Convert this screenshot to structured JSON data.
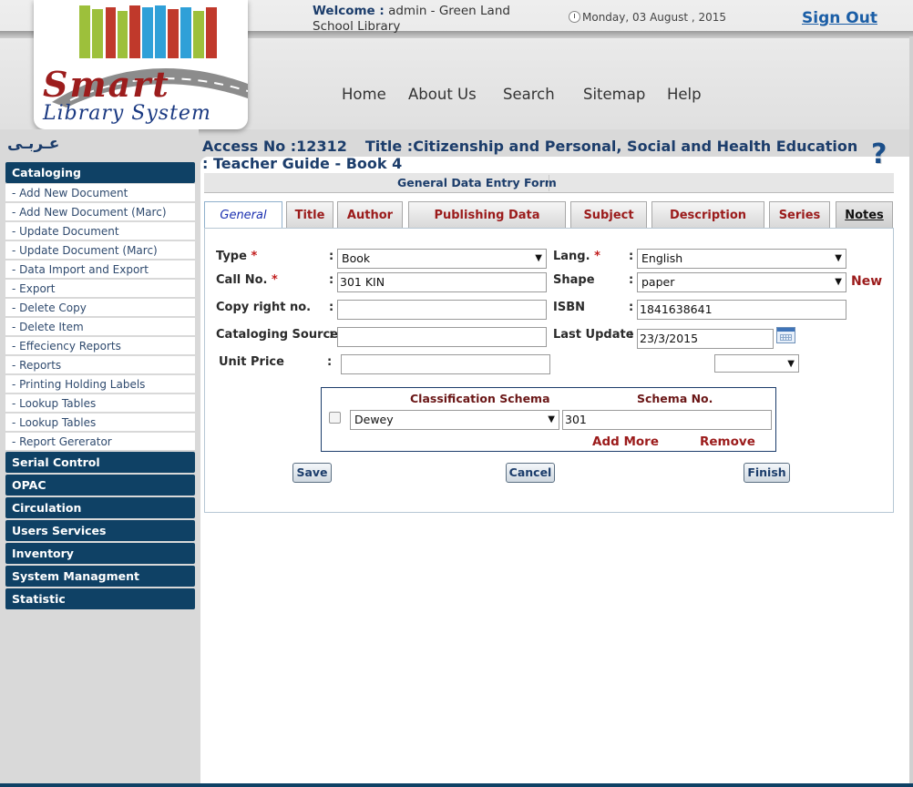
{
  "header": {
    "welcome_label": "Welcome :",
    "welcome_text": "admin - Green Land School Library",
    "date": "Monday, 03 August , 2015",
    "sign_out": "Sign Out",
    "logo_line1": "Smart",
    "logo_line2": "Library System",
    "nav": [
      "Home",
      "About Us",
      "Search",
      "Sitemap",
      "Help"
    ]
  },
  "sidebar": {
    "language_link": "عـربـى",
    "sections": [
      {
        "label": "Cataloging"
      },
      {
        "label": "Serial Control"
      },
      {
        "label": "OPAC"
      },
      {
        "label": "Circulation"
      },
      {
        "label": "Users Services"
      },
      {
        "label": "Inventory"
      },
      {
        "label": "System Managment"
      },
      {
        "label": "Statistic"
      }
    ],
    "cataloging_items": [
      "- Add New Document",
      "- Add New Document (Marc)",
      "- Update Document",
      "- Update Document (Marc)",
      "- Data Import and Export",
      "- Export",
      "- Delete Copy",
      "- Delete Item",
      "- Effeciency Reports",
      "- Reports",
      "- Printing Holding Labels",
      "-  Lookup Tables",
      "- Lookup Tables",
      "- Report Gererator"
    ]
  },
  "page": {
    "heading": "Access No :12312      Title :Citizenship and Personal, Social and Health Education : Teacher Guide - Book 4",
    "access_no": "Access No :12312",
    "title": "Title :Citizenship and Personal, Social and Health Education : Teacher Guide - Book 4",
    "help_symbol": "?",
    "form_title": "General Data Entry Form"
  },
  "tabs": [
    "General",
    "Title",
    "Author",
    "Publishing Data",
    "Subject",
    "Description",
    "Series",
    "Notes"
  ],
  "form": {
    "type_label": "Type",
    "type_value": "Book",
    "lang_label": "Lang.",
    "lang_value": "English",
    "callno_label": "Call No.",
    "callno_value": "301 KIN",
    "shape_label": "Shape",
    "shape_value": "paper",
    "new_link": "New",
    "copyright_label": "Copy right no.",
    "copyright_value": "",
    "isbn_label": "ISBN",
    "isbn_value": "1841638641",
    "catsource_label": "Cataloging Source",
    "catsource_value": "",
    "lastupdate_label": "Last Update",
    "lastupdate_value": "23/3/2015",
    "unitprice_label": "Unit Price",
    "unitprice_value": "",
    "currency_value": "",
    "required_mark": "*",
    "colon": ":"
  },
  "classification": {
    "schema_header": "Classification Schema",
    "no_header": "Schema No.",
    "schema_value": "Dewey",
    "no_value": "301",
    "add_more": "Add More",
    "remove": "Remove"
  },
  "buttons": {
    "save": "Save",
    "cancel": "Cancel",
    "finish": "Finish"
  },
  "icons": {
    "clock": "clock-icon",
    "calendar": "calendar-icon",
    "help": "help-icon",
    "dropdown": "chevron-down-icon"
  }
}
